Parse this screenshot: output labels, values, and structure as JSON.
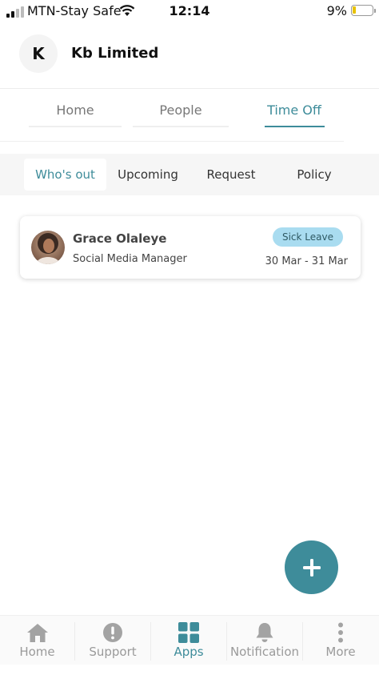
{
  "status_bar": {
    "carrier": "MTN-Stay Safe",
    "time": "12:14",
    "battery_percent": "9%",
    "battery_level": 0.09,
    "icons": [
      "signal-icon",
      "wifi-icon",
      "battery-icon"
    ]
  },
  "header": {
    "avatar_letter": "K",
    "company_name": "Kb Limited"
  },
  "top_tabs": [
    {
      "label": "Home",
      "active": false
    },
    {
      "label": "People",
      "active": false
    },
    {
      "label": "Time Off",
      "active": true
    }
  ],
  "sub_tabs": [
    {
      "label": "Who's out",
      "active": true
    },
    {
      "label": "Upcoming",
      "active": false
    },
    {
      "label": "Request",
      "active": false
    },
    {
      "label": "Policy",
      "active": false
    }
  ],
  "entries": [
    {
      "name": "Grace Olaleye",
      "role": "Social Media Manager",
      "leave_type": "Sick Leave",
      "dates": "30 Mar - 31 Mar"
    }
  ],
  "fab": {
    "icon": "plus-icon"
  },
  "bottom_nav": [
    {
      "label": "Home",
      "icon": "home-icon",
      "active": false
    },
    {
      "label": "Support",
      "icon": "alert-circle-icon",
      "active": false
    },
    {
      "label": "Apps",
      "icon": "grid-icon",
      "active": true
    },
    {
      "label": "Notification",
      "icon": "bell-icon",
      "active": false
    },
    {
      "label": "More",
      "icon": "more-vertical-icon",
      "active": false
    }
  ],
  "colors": {
    "accent": "#3e8c9a",
    "badge_bg": "#a9dcf0",
    "inactive": "#9a9a9a"
  }
}
